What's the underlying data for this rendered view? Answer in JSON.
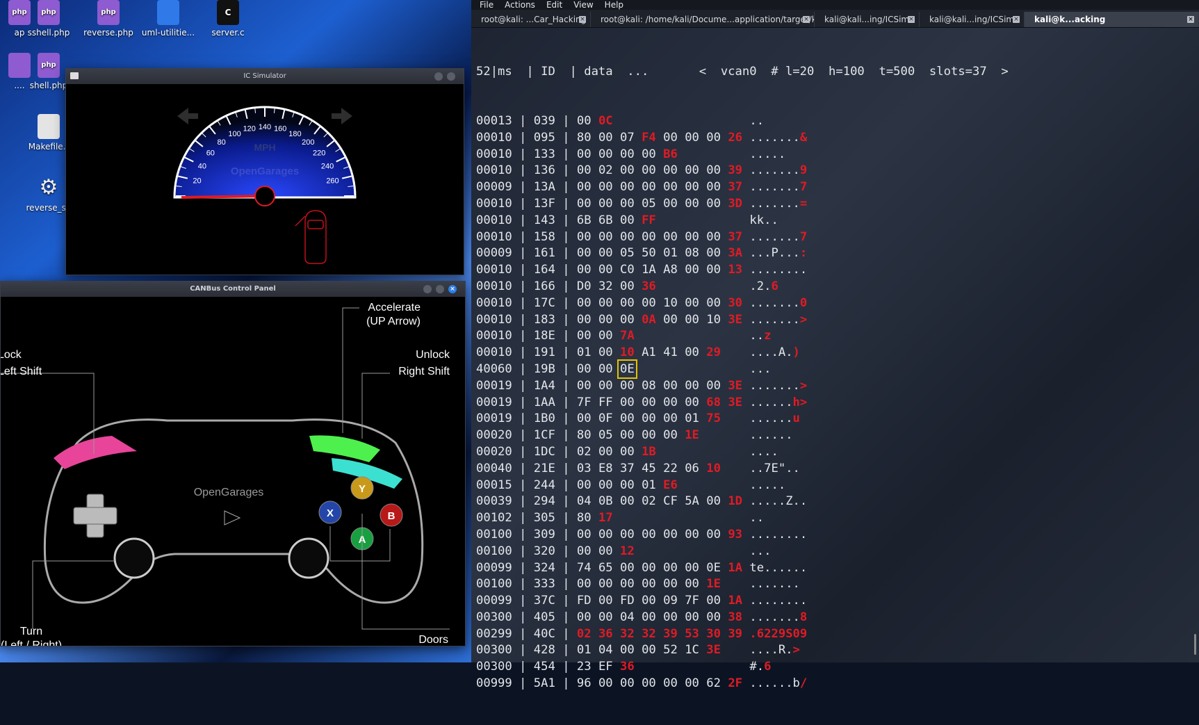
{
  "desktop": {
    "icons": [
      {
        "label": "ap",
        "glyph": "php"
      },
      {
        "label": "sshell.php",
        "glyph": "php"
      },
      {
        "label": "reverse.php",
        "glyph": "php"
      },
      {
        "label": "uml-utilitie...",
        "glyph": ""
      },
      {
        "label": "server.c",
        "glyph": "C"
      },
      {
        "label": "....",
        "glyph": ""
      },
      {
        "label": "shell.php",
        "glyph": "php"
      },
      {
        "label": "Makefile.t",
        "glyph": ""
      },
      {
        "label": "reverse_sh",
        "glyph": "⚙"
      }
    ]
  },
  "ic_simulator": {
    "title": "IC Simulator",
    "unit": "MPH",
    "brand": "OpenGarages",
    "speed_ticks": [
      "20",
      "40",
      "60",
      "80",
      "100",
      "120",
      "140",
      "160",
      "180",
      "200",
      "220",
      "240",
      "260"
    ],
    "needle_mph": 0,
    "speed_max": 280,
    "colors": {
      "dial_inner": "#1e3cff",
      "needle": "#e01b24",
      "door": "#c0111a",
      "arrow": "#2e2e2e"
    }
  },
  "control_panel": {
    "title": "CANBus Control Panel",
    "labels": {
      "accelerate_1": "Accelerate",
      "accelerate_2": "(UP Arrow)",
      "lock_1": "Lock",
      "lock_2": "Left Shift",
      "unlock_1": "Unlock",
      "unlock_2": "Right Shift",
      "turn_1": "Turn",
      "turn_2": "(Left / Right)",
      "doors": "Doors",
      "brand": "OpenGarages"
    },
    "buttons": {
      "y": "Y",
      "x": "X",
      "b": "B",
      "a": "A"
    },
    "colors": {
      "y": "#c99a1a",
      "x": "#2346a8",
      "b": "#b81818",
      "a": "#18a040",
      "lb": "#e8449a",
      "rb": "#4ef04e",
      "rt": "#3ce0d0"
    }
  },
  "terminal": {
    "menu": [
      "File",
      "Actions",
      "Edit",
      "View",
      "Help"
    ],
    "tabs": [
      {
        "label": "root@kali: ...Car_Hacking",
        "active": false
      },
      {
        "label": "root@kali: /home/kali/Docume...application/target/kayak/bin",
        "active": false
      },
      {
        "label": "kali@kali...ing/ICSim",
        "active": false
      },
      {
        "label": "kali@kali...ing/ICSim",
        "active": false
      },
      {
        "label": "kali@k...acking",
        "active": true
      }
    ],
    "colors": {
      "text": "#e3e6ea",
      "changed": "#e01b24",
      "highlight": "#e6c200"
    },
    "header": "52|ms  | ID  | data  ...       <  vcan0  # l=20  h=100  t=500  slots=37  >",
    "rows": [
      {
        "ms": "00013",
        "id": "039",
        "data": [
          "00",
          "0C"
        ],
        "red": [
          1
        ],
        "ascii": "..",
        "ascii_red": []
      },
      {
        "ms": "00010",
        "id": "095",
        "data": [
          "80",
          "00",
          "07",
          "F4",
          "00",
          "00",
          "00",
          "26"
        ],
        "red": [
          3,
          7
        ],
        "ascii": ".......&",
        "ascii_red": [
          7
        ]
      },
      {
        "ms": "00010",
        "id": "133",
        "data": [
          "00",
          "00",
          "00",
          "00",
          "B6"
        ],
        "red": [
          4
        ],
        "ascii": ".....",
        "ascii_red": []
      },
      {
        "ms": "00010",
        "id": "136",
        "data": [
          "00",
          "02",
          "00",
          "00",
          "00",
          "00",
          "00",
          "39"
        ],
        "red": [
          7
        ],
        "ascii": ".......9",
        "ascii_red": [
          7
        ]
      },
      {
        "ms": "00009",
        "id": "13A",
        "data": [
          "00",
          "00",
          "00",
          "00",
          "00",
          "00",
          "00",
          "37"
        ],
        "red": [
          7
        ],
        "ascii": ".......7",
        "ascii_red": [
          7
        ]
      },
      {
        "ms": "00010",
        "id": "13F",
        "data": [
          "00",
          "00",
          "00",
          "05",
          "00",
          "00",
          "00",
          "3D"
        ],
        "red": [
          7
        ],
        "ascii": ".......=",
        "ascii_red": [
          7
        ]
      },
      {
        "ms": "00010",
        "id": "143",
        "data": [
          "6B",
          "6B",
          "00",
          "FF"
        ],
        "red": [
          3
        ],
        "ascii": "kk..",
        "ascii_red": []
      },
      {
        "ms": "00010",
        "id": "158",
        "data": [
          "00",
          "00",
          "00",
          "00",
          "00",
          "00",
          "00",
          "37"
        ],
        "red": [
          7
        ],
        "ascii": ".......7",
        "ascii_red": [
          7
        ]
      },
      {
        "ms": "00009",
        "id": "161",
        "data": [
          "00",
          "00",
          "05",
          "50",
          "01",
          "08",
          "00",
          "3A"
        ],
        "red": [
          7
        ],
        "ascii": "...P...:",
        "ascii_red": [
          7
        ]
      },
      {
        "ms": "00010",
        "id": "164",
        "data": [
          "00",
          "00",
          "C0",
          "1A",
          "A8",
          "00",
          "00",
          "13"
        ],
        "red": [
          7
        ],
        "ascii": "........",
        "ascii_red": []
      },
      {
        "ms": "00010",
        "id": "166",
        "data": [
          "D0",
          "32",
          "00",
          "36"
        ],
        "red": [
          3
        ],
        "ascii": ".2.6",
        "ascii_red": [
          3
        ]
      },
      {
        "ms": "00010",
        "id": "17C",
        "data": [
          "00",
          "00",
          "00",
          "00",
          "10",
          "00",
          "00",
          "30"
        ],
        "red": [
          7
        ],
        "ascii": ".......0",
        "ascii_red": [
          7
        ]
      },
      {
        "ms": "00010",
        "id": "183",
        "data": [
          "00",
          "00",
          "00",
          "0A",
          "00",
          "00",
          "10",
          "3E"
        ],
        "red": [
          3,
          7
        ],
        "ascii": ".......>",
        "ascii_red": [
          7
        ]
      },
      {
        "ms": "00010",
        "id": "18E",
        "data": [
          "00",
          "00",
          "7A"
        ],
        "red": [
          2
        ],
        "ascii": "..z",
        "ascii_red": [
          2
        ]
      },
      {
        "ms": "00010",
        "id": "191",
        "data": [
          "01",
          "00",
          "10",
          "A1",
          "41",
          "00",
          "29"
        ],
        "red": [
          2,
          6
        ],
        "ascii": "....A.)",
        "ascii_red": [
          6
        ]
      },
      {
        "ms": "40060",
        "id": "19B",
        "data": [
          "00",
          "00",
          "0E"
        ],
        "red": [],
        "hl": 2,
        "ascii": "...",
        "ascii_red": []
      },
      {
        "ms": "00019",
        "id": "1A4",
        "data": [
          "00",
          "00",
          "00",
          "08",
          "00",
          "00",
          "00",
          "3E"
        ],
        "red": [
          7
        ],
        "ascii": ".......>",
        "ascii_red": [
          7
        ]
      },
      {
        "ms": "00019",
        "id": "1AA",
        "data": [
          "7F",
          "FF",
          "00",
          "00",
          "00",
          "00",
          "68",
          "3E"
        ],
        "red": [
          6,
          7
        ],
        "ascii": "......h>",
        "ascii_red": [
          6,
          7
        ]
      },
      {
        "ms": "00019",
        "id": "1B0",
        "data": [
          "00",
          "0F",
          "00",
          "00",
          "00",
          "01",
          "75"
        ],
        "red": [
          6
        ],
        "ascii": "......u",
        "ascii_red": [
          6
        ]
      },
      {
        "ms": "00020",
        "id": "1CF",
        "data": [
          "80",
          "05",
          "00",
          "00",
          "00",
          "1E"
        ],
        "red": [
          5
        ],
        "ascii": "......",
        "ascii_red": []
      },
      {
        "ms": "00020",
        "id": "1DC",
        "data": [
          "02",
          "00",
          "00",
          "1B"
        ],
        "red": [
          3
        ],
        "ascii": "....",
        "ascii_red": []
      },
      {
        "ms": "00040",
        "id": "21E",
        "data": [
          "03",
          "E8",
          "37",
          "45",
          "22",
          "06",
          "10"
        ],
        "red": [
          6
        ],
        "ascii": "..7E\"..",
        "ascii_red": []
      },
      {
        "ms": "00015",
        "id": "244",
        "data": [
          "00",
          "00",
          "00",
          "01",
          "E6"
        ],
        "red": [
          4
        ],
        "ascii": ".....",
        "ascii_red": []
      },
      {
        "ms": "00039",
        "id": "294",
        "data": [
          "04",
          "0B",
          "00",
          "02",
          "CF",
          "5A",
          "00",
          "1D"
        ],
        "red": [
          7
        ],
        "ascii": ".....Z..",
        "ascii_red": []
      },
      {
        "ms": "00102",
        "id": "305",
        "data": [
          "80",
          "17"
        ],
        "red": [
          1
        ],
        "ascii": "..",
        "ascii_red": []
      },
      {
        "ms": "00100",
        "id": "309",
        "data": [
          "00",
          "00",
          "00",
          "00",
          "00",
          "00",
          "00",
          "93"
        ],
        "red": [
          7
        ],
        "ascii": "........",
        "ascii_red": []
      },
      {
        "ms": "00100",
        "id": "320",
        "data": [
          "00",
          "00",
          "12"
        ],
        "red": [
          2
        ],
        "ascii": "...",
        "ascii_red": []
      },
      {
        "ms": "00099",
        "id": "324",
        "data": [
          "74",
          "65",
          "00",
          "00",
          "00",
          "00",
          "0E",
          "1A"
        ],
        "red": [
          7
        ],
        "ascii": "te......",
        "ascii_red": []
      },
      {
        "ms": "00100",
        "id": "333",
        "data": [
          "00",
          "00",
          "00",
          "00",
          "00",
          "00",
          "1E"
        ],
        "red": [
          6
        ],
        "ascii": ".......",
        "ascii_red": []
      },
      {
        "ms": "00099",
        "id": "37C",
        "data": [
          "FD",
          "00",
          "FD",
          "00",
          "09",
          "7F",
          "00",
          "1A"
        ],
        "red": [
          7
        ],
        "ascii": "........",
        "ascii_red": []
      },
      {
        "ms": "00300",
        "id": "405",
        "data": [
          "00",
          "00",
          "04",
          "00",
          "00",
          "00",
          "00",
          "38"
        ],
        "red": [
          7
        ],
        "ascii": ".......8",
        "ascii_red": [
          7
        ]
      },
      {
        "ms": "00299",
        "id": "40C",
        "data": [
          "02",
          "36",
          "32",
          "32",
          "39",
          "53",
          "30",
          "39"
        ],
        "red": [
          0,
          1,
          2,
          3,
          4,
          5,
          6,
          7
        ],
        "ascii": ".6229S09",
        "ascii_red": [
          0,
          1,
          2,
          3,
          4,
          5,
          6,
          7
        ]
      },
      {
        "ms": "00300",
        "id": "428",
        "data": [
          "01",
          "04",
          "00",
          "00",
          "52",
          "1C",
          "3E"
        ],
        "red": [
          6
        ],
        "ascii": "....R.>",
        "ascii_red": [
          6
        ]
      },
      {
        "ms": "00300",
        "id": "454",
        "data": [
          "23",
          "EF",
          "36"
        ],
        "red": [
          2
        ],
        "ascii": "#.6",
        "ascii_red": [
          2
        ]
      },
      {
        "ms": "00999",
        "id": "5A1",
        "data": [
          "96",
          "00",
          "00",
          "00",
          "00",
          "00",
          "62",
          "2F"
        ],
        "red": [
          7
        ],
        "ascii": "......b/",
        "ascii_red": [
          7
        ]
      }
    ]
  }
}
